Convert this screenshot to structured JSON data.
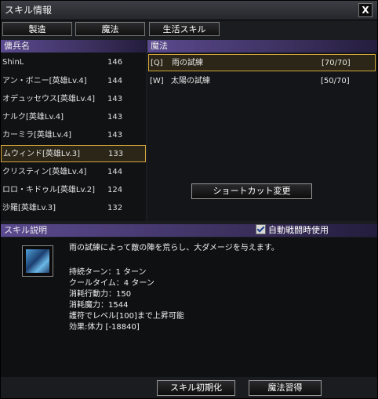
{
  "window": {
    "title": "スキル情報",
    "close_label": "X"
  },
  "tabs": [
    "製造",
    "魔法",
    "生活スキル"
  ],
  "mercenary_panel": {
    "header": "傭兵名",
    "items": [
      {
        "name": "ShinL",
        "level": "146"
      },
      {
        "name": "アン・ボニー[英雄Lv.4]",
        "level": "144"
      },
      {
        "name": "オデュッセウス[英雄Lv.4]",
        "level": "143"
      },
      {
        "name": "ナルク[英雄Lv.4]",
        "level": "143"
      },
      {
        "name": "カーミラ[英雄Lv.4]",
        "level": "143"
      },
      {
        "name": "ムウィンド[英雄Lv.3]",
        "level": "133"
      },
      {
        "name": "クリスティン[英雄Lv.4]",
        "level": "144"
      },
      {
        "name": "ロロ・キドゥル[英雄Lv.2]",
        "level": "124"
      },
      {
        "name": "沙羅[英雄Lv.3]",
        "level": "132"
      }
    ]
  },
  "skill_panel": {
    "header": "魔法",
    "items": [
      {
        "key": "[Q]",
        "name": "雨の試練",
        "points": "[70/70]"
      },
      {
        "key": "[W]",
        "name": "太陽の試練",
        "points": "[50/70]"
      }
    ],
    "shortcut_button": "ショートカット変更"
  },
  "description": {
    "header": "スキル説明",
    "auto_use_label": "自動戦闘時使用",
    "icon": "rain-skill-icon",
    "main_text": "雨の試練によって敵の陣を荒らし、大ダメージを与えます。",
    "stats": [
      "持続ターン：1 ターン",
      "クールタイム：4 ターン",
      "消耗行動力：150",
      "消耗魔力：1544",
      "護符でレベル[100]まで上昇可能",
      "効果:体力 [-18840]"
    ]
  },
  "buttons": {
    "reset": "スキル初期化",
    "learn": "魔法習得"
  },
  "colors": {
    "header": "#5b4a8f",
    "selection": "#d4a73a"
  }
}
